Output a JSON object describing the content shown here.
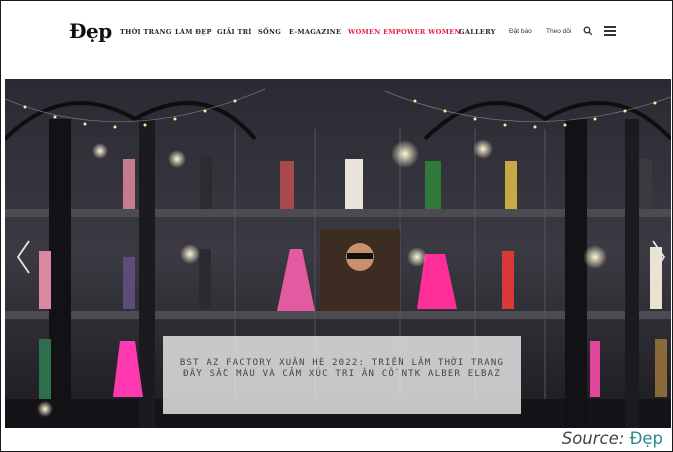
{
  "nav": {
    "logo": "Đẹp",
    "menu": [
      {
        "label": "THỜI TRANG"
      },
      {
        "label": "LÀM ĐẸP"
      },
      {
        "label": "GIẢI TRÍ"
      },
      {
        "label": "SỐNG"
      },
      {
        "label": "E-MAGAZINE"
      },
      {
        "label": "WOMEN EMPOWER WOMEN",
        "highlight": true
      },
      {
        "label": "GALLERY"
      }
    ],
    "subscribe": "Đặt báo",
    "follow": "Theo dõi",
    "search_icon": "search-icon",
    "menu_icon": "hamburger-menu-icon"
  },
  "hero": {
    "caption_line1": "BST AZ FACTORY XUÂN HÈ 2022: TRIỂN LÃM THỜI TRANG",
    "caption_line2": "ĐẦY SẮC MÀU VÀ CẢM XÚC TRI ÂN CỐ NTK ALBER ELBAZ",
    "prev_icon": "chevron-left-icon",
    "next_icon": "chevron-right-icon"
  },
  "source": {
    "label": "Source:",
    "value": "Đẹp"
  },
  "colors": {
    "accent": "#e21b3c",
    "source_link": "#2a8a8a",
    "hero_bg": "#1d1d22"
  }
}
